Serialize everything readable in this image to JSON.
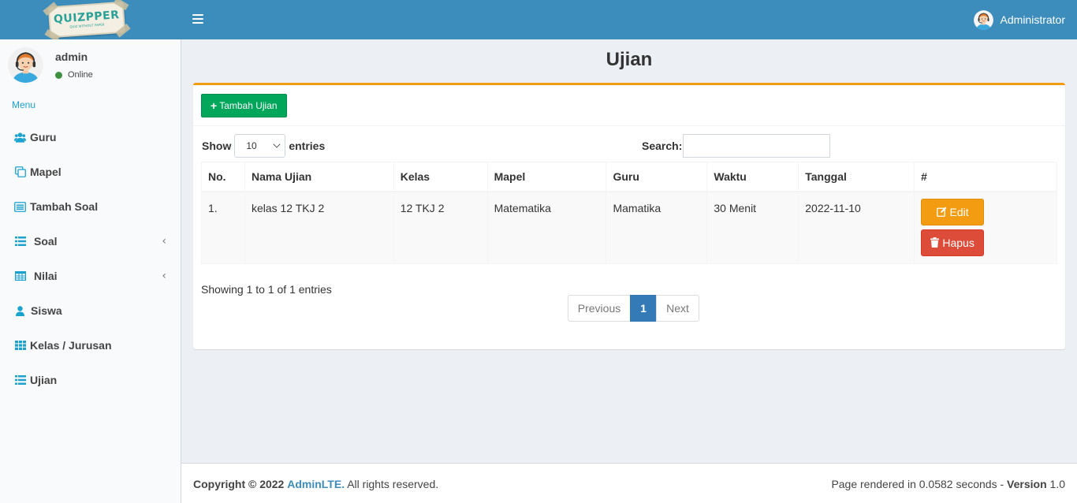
{
  "app": {
    "logo_text": "QUIZPPER",
    "logo_subtext": "QUIZ WITHOUT PAPER"
  },
  "header": {
    "user_name": "Administrator"
  },
  "sidebar": {
    "user": {
      "name": "admin",
      "status": "Online",
      "status_color": "#3d9140"
    },
    "menu_header": "Menu",
    "items": [
      {
        "label": "Guru",
        "icon": "users-icon"
      },
      {
        "label": "Mapel",
        "icon": "copy-icon"
      },
      {
        "label": "Tambah Soal",
        "icon": "list-alt-icon"
      },
      {
        "label": "Soal",
        "icon": "list-icon",
        "has_submenu": true
      },
      {
        "label": "Nilai",
        "icon": "table-icon",
        "has_submenu": true
      },
      {
        "label": "Siswa",
        "icon": "user-icon"
      },
      {
        "label": "Kelas / Jurusan",
        "icon": "th-icon"
      },
      {
        "label": "Ujian",
        "icon": "list-icon"
      }
    ]
  },
  "main": {
    "title": "Ujian",
    "add_button": "Tambah Ujian",
    "length": {
      "show_label": "Show",
      "value": "10",
      "entries_label": "entries"
    },
    "search": {
      "label": "Search:",
      "value": ""
    },
    "table": {
      "columns": [
        "No.",
        "Nama Ujian",
        "Kelas",
        "Mapel",
        "Guru",
        "Waktu",
        "Tanggal",
        "#"
      ],
      "rows": [
        {
          "no": "1.",
          "nama_ujian": "kelas 12 TKJ 2",
          "kelas": "12 TKJ 2",
          "mapel": "Matematika",
          "guru": "Mamatika",
          "waktu": "30 Menit",
          "tanggal": "2022-11-10",
          "edit_label": "Edit",
          "delete_label": "Hapus"
        }
      ]
    },
    "info": "Showing 1 to 1 of 1 entries",
    "pagination": {
      "previous": "Previous",
      "current": "1",
      "next": "Next"
    }
  },
  "footer": {
    "copyright_prefix": "Copyright © 2022",
    "brand": "AdminLTE.",
    "rights": "All rights reserved.",
    "render_text": "Page rendered in 0.0582 seconds -",
    "version_label": "Version",
    "version": "1.0"
  },
  "colors": {
    "header": "#3c8dbc",
    "accent_top": "#f39c12",
    "add_button": "#00a65a",
    "edit_button": "#f39c12",
    "delete_button": "#dd4b39",
    "active_page": "#337ab7",
    "menu_icon": "#1ba3cf"
  }
}
